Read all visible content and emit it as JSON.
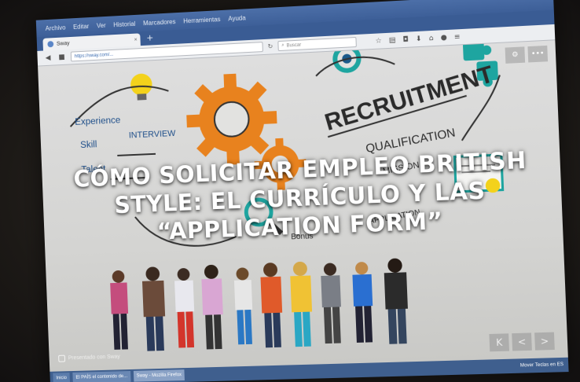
{
  "browser": {
    "menu": [
      "Archivo",
      "Editar",
      "Ver",
      "Historial",
      "Marcadores",
      "Herramientas",
      "Ayuda"
    ],
    "tab_title": "Sway",
    "url": "https://sway.com/...",
    "search_placeholder": "Buscar"
  },
  "slide": {
    "headline_line1": "CÓMO SOLICITAR EMPLEO BRITISH",
    "headline_line2": "STYLE: EL CURRÍCULO Y LAS",
    "headline_line3": "“APPLICATION FORM”",
    "illustration_words": {
      "recruitment": "RECRUITMENT",
      "experience": "Experience",
      "skill": "Skill",
      "talent": "Talent",
      "interview": "INTERVIEW",
      "qualification": "QUALIFICATION",
      "mission": "MISSION",
      "application": "APPLICATION",
      "bonus": "Bonus"
    },
    "brand": "Presentado con Sway"
  },
  "controls": {
    "first": "K",
    "prev": "<",
    "next": ">"
  },
  "taskbar": {
    "start": "Inicio",
    "items": [
      "El PAÍS el contenido de...",
      "Sway - Mozilla Firefox"
    ],
    "tray": "Mover Teclas en ES"
  },
  "colors": {
    "title_bar": "#3d5f98",
    "gear_orange": "#e8821e",
    "accent_teal": "#1ea5a0",
    "headline_text": "#ffffff"
  }
}
